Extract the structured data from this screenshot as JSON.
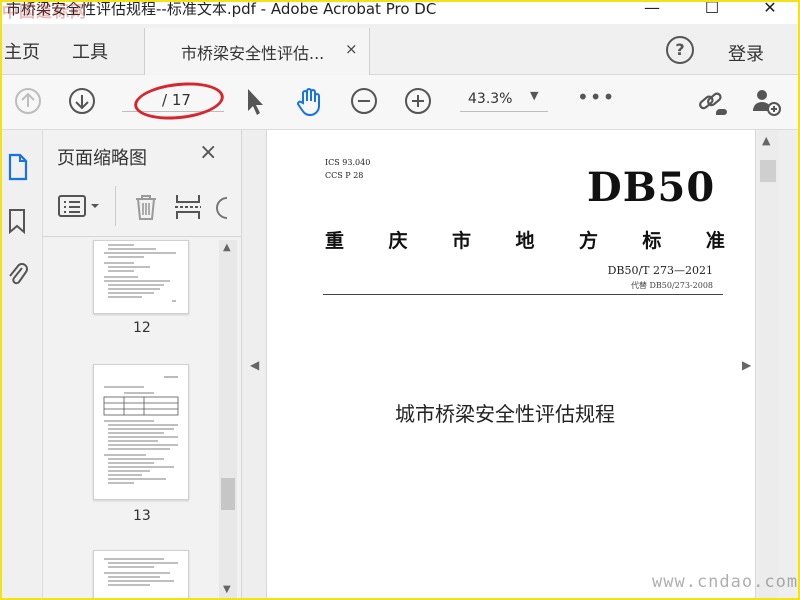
{
  "window": {
    "title": "市桥梁安全性评估规程--标准文本.pdf - Adobe Acrobat Pro DC",
    "watermark": "中国道标网",
    "minimize": "—",
    "maximize": "☐",
    "close": "✕"
  },
  "tabs": {
    "home": "主页",
    "tools": "工具",
    "document": "市桥梁安全性评估...",
    "close": "×",
    "help": "?",
    "login": "登录"
  },
  "toolbar": {
    "page_count": "/ 17",
    "zoom": "43.3%",
    "more": "•••"
  },
  "thumbnails": {
    "title": "页面缩略图",
    "close": "×",
    "pages": [
      "12",
      "13"
    ]
  },
  "document": {
    "ics": "ICS  93.040",
    "ccs": "CCS  P  28",
    "code": "DB50",
    "standard_title": [
      "重",
      "庆",
      "市",
      "地",
      "方",
      "标",
      "准"
    ],
    "standard_number": "DB50/T  273—2021",
    "supersedes": "代替 DB50/273-2008",
    "main_title": "城市桥梁安全性评估规程"
  },
  "footer_watermark": "www.cndao.com",
  "colors": {
    "frame_border": "#f2e21a",
    "annotation_ellipse": "#d9262c",
    "hand_tool_active": "#1473e6"
  }
}
